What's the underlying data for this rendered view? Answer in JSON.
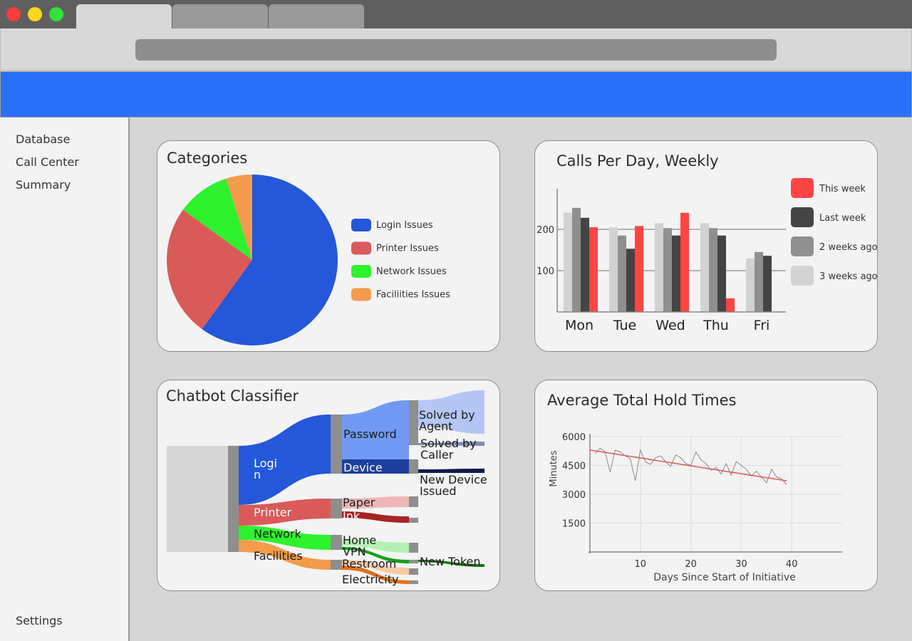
{
  "browser": {
    "tabs": [
      {
        "label": ""
      },
      {
        "label": ""
      },
      {
        "label": ""
      }
    ],
    "url": ""
  },
  "sidebar": {
    "items": [
      {
        "label": "Database"
      },
      {
        "label": "Call Center"
      },
      {
        "label": "Summary"
      }
    ],
    "settings_label": "Settings"
  },
  "colors": {
    "accent": "#2b6ff9",
    "login": "#2457d9",
    "printer": "#da5a5a",
    "network": "#2df22d",
    "facilities": "#f29b4b",
    "this_week": "#ff4444",
    "last_week": "#444444",
    "two_weeks": "#8f8f8f",
    "three_weeks": "#d2d2d2"
  },
  "categories_card": {
    "title": "Categories",
    "chart_data": {
      "type": "pie",
      "title": "Categories",
      "slices": [
        {
          "label": "Login Issues",
          "value": 60,
          "color": "#2457d9"
        },
        {
          "label": "Printer Issues",
          "value": 25,
          "color": "#da5a5a"
        },
        {
          "label": "Network Issues",
          "value": 10,
          "color": "#2df22d"
        },
        {
          "label": "Faciliities Issues",
          "value": 5,
          "color": "#f29b4b"
        }
      ],
      "legend": "right"
    }
  },
  "calls_card": {
    "title": "Calls Per Day, Weekly",
    "chart_data": {
      "type": "bar",
      "title": "Calls Per Day, Weekly",
      "categories": [
        "Mon",
        "Tue",
        "Wed",
        "Thu",
        "Fri"
      ],
      "series": [
        {
          "name": "3 weeks ago",
          "color": "#d2d2d2",
          "values": [
            240,
            205,
            215,
            215,
            130
          ]
        },
        {
          "name": "2 weeks ago",
          "color": "#8f8f8f",
          "values": [
            252,
            185,
            203,
            203,
            145
          ]
        },
        {
          "name": "Last week",
          "color": "#444444",
          "values": [
            228,
            153,
            185,
            185,
            136
          ]
        },
        {
          "name": "This week",
          "color": "#ff4444",
          "values": [
            205,
            208,
            240,
            33,
            null
          ]
        }
      ],
      "yticks": [
        100,
        200
      ],
      "ylim": [
        0,
        300
      ],
      "grid": "horizontal",
      "legend": "right"
    }
  },
  "chatbot_card": {
    "title": "Chatbot Classifier",
    "chart_data": {
      "type": "sankey",
      "levels": [
        [
          "",
          "Login",
          "Printer",
          "Network",
          "Facilities"
        ],
        [
          "Password",
          "Device",
          "Paper",
          "Ink",
          "Home",
          "VPN",
          "Restroom",
          "Electricity"
        ],
        [
          "Solved by Agent",
          "Solved by Caller",
          "New Device Issued",
          "New Token"
        ]
      ],
      "flows": [
        {
          "from": "",
          "to": "Login",
          "value": 45
        },
        {
          "from": "",
          "to": "Printer",
          "value": 12
        },
        {
          "from": "",
          "to": "Network",
          "value": 8
        },
        {
          "from": "",
          "to": "Facilities",
          "value": 6
        },
        {
          "from": "Login",
          "to": "Password",
          "value": 35
        },
        {
          "from": "Login",
          "to": "Device",
          "value": 10
        },
        {
          "from": "Printer",
          "to": "Paper",
          "value": 7
        },
        {
          "from": "Printer",
          "to": "Ink",
          "value": 5
        },
        {
          "from": "Network",
          "to": "Home",
          "value": 5
        },
        {
          "from": "Network",
          "to": "VPN",
          "value": 3
        },
        {
          "from": "Facilities",
          "to": "Restroom",
          "value": 3
        },
        {
          "from": "Facilities",
          "to": "Electricity",
          "value": 3
        },
        {
          "from": "Password",
          "to": "Solved by Agent",
          "value": 30
        },
        {
          "from": "Password",
          "to": "Solved by Caller",
          "value": 3
        },
        {
          "from": "Device",
          "to": "New Device Issued",
          "value": 2
        },
        {
          "from": "VPN",
          "to": "New Token",
          "value": 2
        }
      ],
      "node_labels": {
        "login": [
          "Logi",
          "n"
        ],
        "password": "Password",
        "device": "Device",
        "printer": "Printer",
        "network": "Network",
        "facilities": "Facilities",
        "paper": "Paper",
        "ink": "Ink",
        "home": "Home",
        "vpn": "VPN",
        "restroom": "Restroom",
        "electricity": "Electricity",
        "solved_agent": [
          "Solved by",
          "Agent"
        ],
        "solved_caller": [
          "Solved by",
          "Caller"
        ],
        "new_device": [
          "New Device",
          "Issued"
        ],
        "new_token": "New Token"
      }
    }
  },
  "hold_card": {
    "title": "Average Total Hold Times",
    "chart_data": {
      "type": "line",
      "title": "Average Total Hold Times",
      "xlabel": "Days Since Start of Initiative",
      "ylabel": "Minutes",
      "xticks": [
        10,
        20,
        30,
        40
      ],
      "yticks": [
        1500,
        3000,
        4500,
        6000
      ],
      "xlim": [
        0,
        50
      ],
      "ylim": [
        0,
        6000
      ],
      "grid": true,
      "series": [
        {
          "color": "#888888",
          "x": [
            1,
            2,
            3,
            4,
            5,
            6,
            7,
            8,
            9,
            10,
            11,
            12,
            13,
            14,
            15,
            16,
            17,
            18,
            19,
            20,
            21,
            22,
            23,
            24,
            25,
            26,
            27,
            28,
            29,
            30,
            31,
            32,
            33,
            34,
            35,
            36,
            37,
            38,
            39
          ],
          "y": [
            5100,
            5400,
            5200,
            4150,
            5300,
            5200,
            5000,
            4850,
            3700,
            5300,
            4700,
            4550,
            4900,
            5000,
            4700,
            4450,
            5050,
            4900,
            4600,
            4500,
            5200,
            4800,
            4600,
            4250,
            4400,
            4050,
            4600,
            4000,
            4700,
            4500,
            4300,
            3950,
            4200,
            3900,
            3600,
            4300,
            3900,
            3800,
            3500
          ]
        },
        {
          "color": "#e05a5a",
          "x": [
            0,
            39
          ],
          "y": [
            5300,
            3700
          ]
        }
      ]
    }
  }
}
